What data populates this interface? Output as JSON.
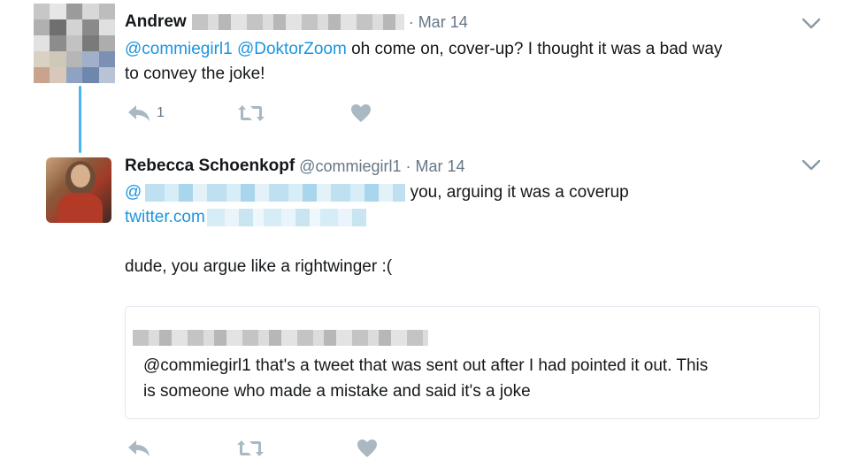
{
  "tweet1": {
    "name": "Andrew",
    "date": "Mar 14",
    "mention1": "@commiegirl1",
    "mention2": "@DoktorZoom",
    "text_line1": "oh come on, cover-up? I thought it was a bad way",
    "text_line2": "to convey the joke!",
    "reply_count": "1",
    "icons": {
      "reply": "reply-icon",
      "retweet": "retweet-icon",
      "like": "heart-icon",
      "menu": "chevron-down-icon"
    }
  },
  "tweet2": {
    "name": "Rebecca Schoenkopf",
    "handle": "@commiegirl1",
    "date": "Mar 14",
    "at": "@",
    "text_after_mention": "you, arguing it was a coverup",
    "link_prefix": "twitter.com",
    "body": "dude, you argue like a rightwinger :(",
    "quote": {
      "text_line1": "@commiegirl1 that's a tweet that was sent out after I had pointed it out. This",
      "text_line2": "is someone who made a mistake and said it's a joke"
    },
    "icons": {
      "reply": "reply-icon",
      "retweet": "retweet-icon",
      "like": "heart-icon",
      "menu": "chevron-down-icon"
    }
  },
  "colors": {
    "link": "#1b95e0",
    "thread_line": "#4ab3f4",
    "muted": "#657786",
    "action_icon": "#aab8c2"
  }
}
